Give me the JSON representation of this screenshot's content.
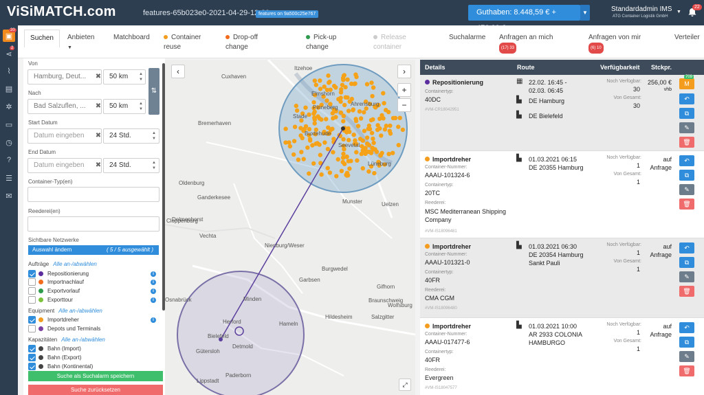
{
  "app": {
    "logo": "ViSiMATCH.com",
    "build": "features-65b023e0-2021-04-29-12-39",
    "build_badge": "features on 9a500c25e767",
    "balance": "Guthaben: 8.448,59 € + 476,00 €",
    "user_name": "Standardadmin IMS",
    "user_company": "ATG Container Logistik GmbH",
    "bell_count": "22"
  },
  "leftnav": {
    "badge_1": "20",
    "badge_2": "2",
    "icons": [
      "home-icon",
      "share-icon",
      "chart-icon",
      "id-card-icon",
      "gears-icon",
      "money-icon",
      "timer-icon",
      "help-icon",
      "list-icon",
      "mail-icon"
    ]
  },
  "tabs": [
    {
      "label": "Suchen"
    },
    {
      "label": "Anbieten"
    },
    {
      "label": "Matchboard"
    },
    {
      "label": "Container reuse",
      "color": "#f39c1e"
    },
    {
      "label": "Drop-off change",
      "color": "#f36b1c"
    },
    {
      "label": "Pick-up change",
      "color": "#2e9a4b"
    },
    {
      "label": "Release container",
      "color": "#cccccc"
    },
    {
      "label": "Suchalarme"
    },
    {
      "label": "Anfragen an mich",
      "badge": "(17) 33"
    },
    {
      "label": "Anfragen von mir",
      "badge": "(6) 10"
    },
    {
      "label": "Verteiler"
    }
  ],
  "search": {
    "von_label": "Von",
    "von_value": "Hamburg, Deut...",
    "von_radius": "50 km",
    "nach_label": "Nach",
    "nach_value": "Bad Salzuflen, ...",
    "nach_radius": "50 km",
    "start_label": "Start Datum",
    "start_placeholder": "Datum eingeben",
    "start_range": "24 Std.",
    "end_label": "End Datum",
    "end_placeholder": "Datum eingeben",
    "end_range": "24 Std.",
    "container_type_label": "Container-Typ(en)",
    "reederei_label": "Reederei(en)",
    "networks_label": "Sichtbare Netzwerke",
    "networks_button": "Auswahl ändern",
    "networks_count": "( 5 / 5 ausgewählt )",
    "auftraege_label": "Aufträge",
    "toggle_all": "Alle an-/abwählen",
    "auftraege": [
      {
        "label": "Repositionierung",
        "color": "#5b2d9e",
        "checked": true
      },
      {
        "label": "Importnachlauf",
        "color": "#f36b1c",
        "checked": false
      },
      {
        "label": "Exportvorlauf",
        "color": "#2e9a4b",
        "checked": false
      },
      {
        "label": "Exporttour",
        "color": "#7cc23f",
        "checked": false
      }
    ],
    "equipment_label": "Equipment",
    "equipment": [
      {
        "label": "Importdreher",
        "color": "#f39c1e",
        "checked": true
      },
      {
        "label": "Depots und Terminals",
        "color": "#7b3fa0",
        "checked": false
      }
    ],
    "kapazitaeten_label": "Kapazitäten",
    "kapazitaeten": [
      {
        "label": "Bahn (Import)",
        "color": "#444444",
        "checked": true
      },
      {
        "label": "Bahn (Export)",
        "color": "#444444",
        "checked": true
      },
      {
        "label": "Bahn (Kontinental)",
        "color": "#444444",
        "checked": true
      }
    ],
    "save_alarm": "Suche als Suchalarm speichern",
    "reset": "Suche zurücksetzen"
  },
  "map": {
    "cities": [
      "Cuxhaven",
      "Itzehoe",
      "Elmshorn",
      "Pinneberg",
      "Ahrensburg",
      "Stade",
      "Buxtehude",
      "Seevetal",
      "Lüneburg",
      "Bremerhaven",
      "Oldenburg",
      "Ganderkesee",
      "Delmenhorst",
      "Cloppenburg",
      "Vechta",
      "Munster",
      "Uelzen",
      "Nienburg/Weser",
      "Burgwedel",
      "Garbsen",
      "Gifhorn",
      "Wolfsburg",
      "Braunschweig",
      "Osnabrück",
      "Minden",
      "Herford",
      "Bielefeld",
      "Hameln",
      "Hildesheim",
      "Salzgitter",
      "Detmold",
      "Gütersloh",
      "Paderborn",
      "Lippstadt",
      "Gifhorn"
    ],
    "zoom_in": "+",
    "zoom_out": "−"
  },
  "results": {
    "headers": {
      "details": "Details",
      "route": "Route",
      "availability": "Verfügbarkeit",
      "price": "Stckpr."
    },
    "labels": {
      "containertyp": "Containertyp:",
      "containernummer": "Container-Nummer:",
      "reederei": "Reederei:",
      "noch": "Noch Verfügbar:",
      "gesamt": "Von Gesamt:"
    },
    "items": [
      {
        "title": "Repositionierung",
        "color": "#5b2d9e",
        "containertyp": "40DC",
        "id": "#VM-CR18042951",
        "dates": "22.02. 16:45 -",
        "dates2": "02.03. 06:45",
        "from": "DE Hamburg",
        "to": "DE Bielefeld",
        "noch": "30",
        "gesamt": "30",
        "price": "256,00 €",
        "price_unit": "vhb",
        "m_badge": "709",
        "m_label": "M"
      },
      {
        "title": "Importdreher",
        "color": "#f39c1e",
        "containernummer": "AAAU-101324-6",
        "containertyp": "20TC",
        "reederei": "MSC Mediterranean Shipping Company",
        "id": "#VM-IS18096481",
        "dates": "01.03.2021 06:15",
        "from": "DE 20355 Hamburg",
        "noch": "1",
        "gesamt": "1",
        "price": "auf",
        "price2": "Anfrage"
      },
      {
        "title": "Importdreher",
        "color": "#f39c1e",
        "containernummer": "AAAU-101321-0",
        "containertyp": "40FR",
        "reederei": "CMA CGM",
        "id": "#VM-IS18096480",
        "dates": "01.03.2021 06:30",
        "from": "DE 20354 Hamburg",
        "from2": "Sankt Pauli",
        "noch": "1",
        "gesamt": "1",
        "price": "auf",
        "price2": "Anfrage"
      },
      {
        "title": "Importdreher",
        "color": "#f39c1e",
        "containernummer": "AAAU-017477-6",
        "containertyp": "40FR",
        "reederei": "Evergreen",
        "id": "#VM-IS18047577",
        "dates": "01.03.2021 10:00",
        "from": "AR 2933 COLONIA",
        "from2": "HAMBURGO",
        "noch": "1",
        "gesamt": "1",
        "price": "auf",
        "price2": "Anfrage"
      }
    ]
  }
}
